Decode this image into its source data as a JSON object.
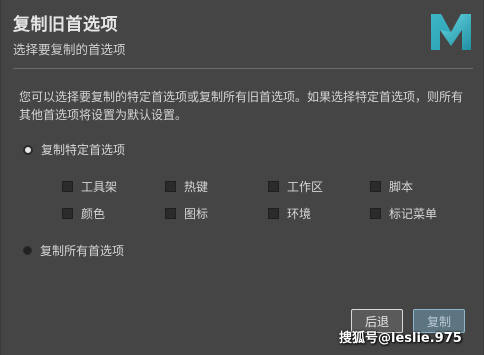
{
  "dialog": {
    "title": "复制旧首选项",
    "subtitle": "选择要复制的首选项",
    "logo_icon": "maya-logo",
    "description": "您可以选择要复制的特定首选项或复制所有旧首选项。如果选择特定首选项，则所有其他首选项将设置为默认设置。",
    "option_specific": {
      "label": "复制特定首选项",
      "selected": true
    },
    "option_all": {
      "label": "复制所有首选项",
      "selected": false
    },
    "checkboxes": [
      {
        "label": "工具架",
        "checked": false
      },
      {
        "label": "热键",
        "checked": false
      },
      {
        "label": "工作区",
        "checked": false
      },
      {
        "label": "脚本",
        "checked": false
      },
      {
        "label": "颜色",
        "checked": false
      },
      {
        "label": "图标",
        "checked": false
      },
      {
        "label": "环境",
        "checked": false
      },
      {
        "label": "标记菜单",
        "checked": false
      }
    ],
    "buttons": {
      "back_label": "后退",
      "copy_label": "复制"
    },
    "watermark": "搜狐号@leslie.975"
  },
  "colors": {
    "background": "#454545",
    "copy_button": "#5d7481",
    "logo_teal": "#3fb8c9"
  }
}
